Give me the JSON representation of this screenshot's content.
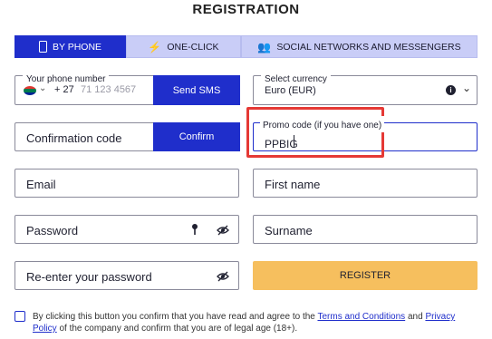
{
  "title": "REGISTRATION",
  "tabs": [
    {
      "label": "BY PHONE",
      "icon": "phone-icon"
    },
    {
      "label": "ONE-CLICK",
      "icon": "lightning-icon"
    },
    {
      "label": "SOCIAL NETWORKS AND MESSENGERS",
      "icon": "people-icon"
    }
  ],
  "phone": {
    "label": "Your phone number",
    "country_code": "+ 27",
    "placeholder": "71 123 4567",
    "send_sms": "Send SMS"
  },
  "currency": {
    "label": "Select currency",
    "value": "Euro (EUR)"
  },
  "confirmation": {
    "label": "Confirmation code",
    "button": "Confirm"
  },
  "promo": {
    "label": "Promo code (if you have one)",
    "value": "PPBIG"
  },
  "email": {
    "label": "Email"
  },
  "first_name": {
    "label": "First name"
  },
  "password": {
    "label": "Password"
  },
  "surname": {
    "label": "Surname"
  },
  "reenter_password": {
    "label": "Re-enter your password"
  },
  "register": {
    "label": "REGISTER"
  },
  "legal": {
    "prefix": "By clicking this button you confirm that you have read and agree to the",
    "terms": "Terms and Conditions",
    "and": "and",
    "privacy": "Privacy Policy",
    "suffix": "of the company and confirm that you are of legal age (18+)."
  },
  "colors": {
    "accent": "#1f2ecb",
    "tab_inactive": "#c9cdf7",
    "register": "#f6bf5e",
    "highlight": "#e53935"
  }
}
